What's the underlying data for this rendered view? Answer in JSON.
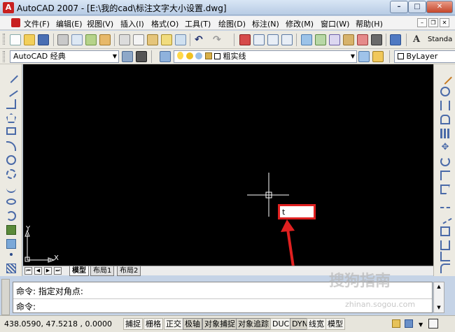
{
  "window": {
    "title": "AutoCAD 2007 - [E:\\我的cad\\标注文字大小设置.dwg]",
    "app_icon_letter": "A",
    "controls": {
      "minimize": "–",
      "maximize": "□",
      "close": "✕"
    }
  },
  "menubar": {
    "items": [
      "文件(F)",
      "编辑(E)",
      "视图(V)",
      "插入(I)",
      "格式(O)",
      "工具(T)",
      "绘图(D)",
      "标注(N)",
      "修改(M)",
      "窗口(W)",
      "帮助(H)"
    ],
    "doc_controls": {
      "minimize": "–",
      "restore": "❐",
      "close": "✕"
    }
  },
  "toolbar": {
    "workspace_combo": "AutoCAD 经典",
    "layer_combo": "粗实线",
    "color_combo": "ByLayer",
    "text_style": "Standa",
    "combo_arrow": "▼"
  },
  "drawing": {
    "ucs": {
      "x_label": "X",
      "y_label": "Y"
    },
    "dynamic_input": "t",
    "annotation_color": "#e02020"
  },
  "layout_tabs": {
    "nav": [
      "⏮",
      "◀",
      "▶",
      "⏭"
    ],
    "tabs": [
      "模型",
      "布局1",
      "布局2"
    ],
    "active": "模型"
  },
  "command_window": {
    "lines": [
      "命令: 指定对角点:",
      "命令:"
    ]
  },
  "statusbar": {
    "coordinates": "438.0590, 47.5218  , 0.0000",
    "buttons": [
      "捕捉",
      "栅格",
      "正交",
      "极轴",
      "对象捕捉",
      "对象追踪",
      "DUCS",
      "DYN",
      "线宽",
      "模型"
    ]
  },
  "watermark": {
    "brand": "搜狗指南",
    "url": "zhinan.sogou.com"
  }
}
